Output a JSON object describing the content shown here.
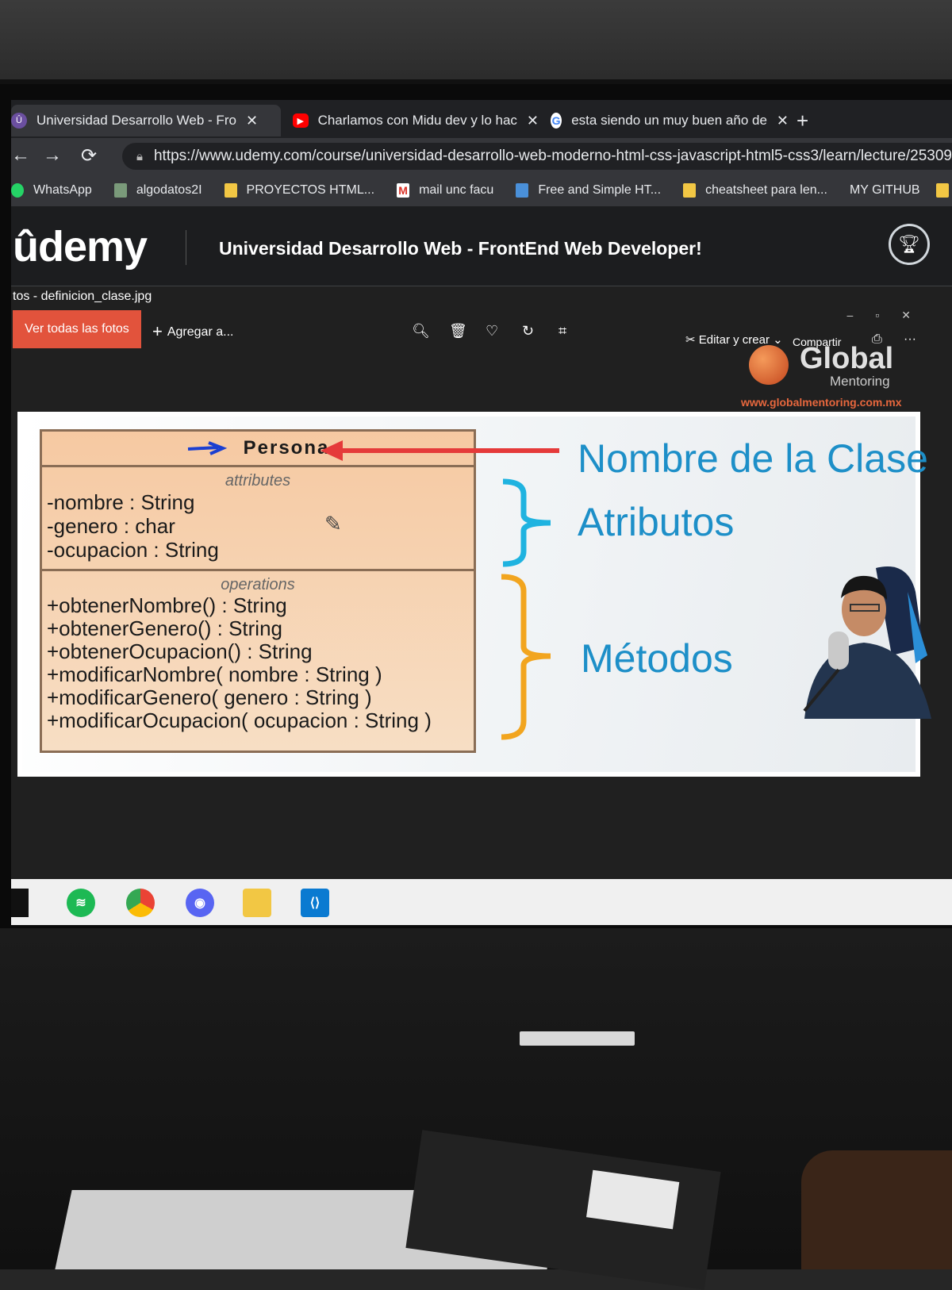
{
  "browser": {
    "tabs": [
      {
        "label": "Universidad Desarrollo Web - Fro",
        "icon": "udemy-icon",
        "active": true
      },
      {
        "label": "Charlamos con Midu dev y lo hac",
        "icon": "youtube-icon",
        "active": false
      },
      {
        "label": "esta siendo un muy buen año de",
        "icon": "google-icon",
        "active": false
      }
    ],
    "url": "https://www.udemy.com/course/universidad-desarrollo-web-moderno-html-css-javascript-html5-css3/learn/lecture/25309",
    "bookmarks": [
      {
        "label": "WhatsApp",
        "icon": "whatsapp-icon"
      },
      {
        "label": "algodatos2I",
        "icon": "bookmark-icon"
      },
      {
        "label": "PROYECTOS HTML...",
        "icon": "folder-icon"
      },
      {
        "label": "mail unc facu",
        "icon": "gmail-icon"
      },
      {
        "label": "Free and Simple HT...",
        "icon": "bookmark-icon"
      },
      {
        "label": "cheatsheet para len...",
        "icon": "folder-icon"
      },
      {
        "label": "MY GITHUB",
        "icon": "folder-icon"
      }
    ]
  },
  "udemy": {
    "logo": "ûdemy",
    "course_title": "Universidad Desarrollo Web - FrontEnd Web Developer!"
  },
  "viewer": {
    "filename": "tos - definicion_clase.jpg",
    "ver_todas": "Ver todas las fotos",
    "agregar": "Agregar a...",
    "editar": "Editar y crear",
    "compartir": "Compartir"
  },
  "watermark": {
    "word": "Global",
    "sub": "Mentoring",
    "url": "www.globalmentoring.com.mx"
  },
  "slide": {
    "class_name": "Persona",
    "attributes_label": "attributes",
    "attributes": [
      "-nombre : String",
      "-genero : char",
      "-ocupacion : String"
    ],
    "operations_label": "operations",
    "operations": [
      "+obtenerNombre() : String",
      "+obtenerGenero() : String",
      "+obtenerOcupacion() : String",
      "+modificarNombre( nombre : String )",
      "+modificarGenero( genero : String )",
      "+modificarOcupacion( ocupacion : String )"
    ],
    "label_class": "Nombre de la Clase",
    "label_attrs": "Atributos",
    "label_methods": "Métodos"
  },
  "colors": {
    "arrow": "#e53a3a",
    "brace_attrs": "#1fb3e0",
    "brace_methods": "#f2a51f",
    "label_text": "#1d8fc8",
    "udemy_purple": "#a435f0",
    "photos_accent": "#e2533c"
  },
  "taskbar": [
    "windows-icon",
    "spotify-icon",
    "chrome-icon",
    "discord-icon",
    "file-explorer-icon",
    "vscode-icon"
  ]
}
